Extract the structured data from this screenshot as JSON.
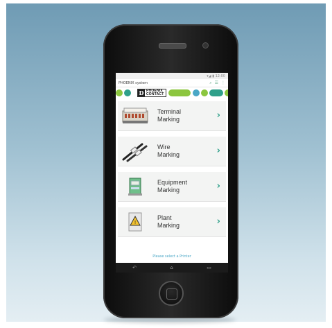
{
  "statusbar": {
    "text": "▾◢ ▮ 12:00"
  },
  "appbar": {
    "title": "PHOENIX system",
    "icons": [
      "search-icon",
      "list-icon",
      "more-icon"
    ],
    "icon_glyphs": [
      "⌕",
      "☰",
      "⋮"
    ]
  },
  "brand": {
    "mark": "D",
    "name_line1": "PHOENIX",
    "name_line2": "CONTACT",
    "colors": {
      "green": "#8cc63f",
      "teal": "#2fa08a",
      "blue": "#4aa7c6"
    }
  },
  "menu": [
    {
      "line1": "Terminal",
      "line2": "Marking",
      "icon": "terminal-block-icon"
    },
    {
      "line1": "Wire",
      "line2": "Marking",
      "icon": "wire-icon"
    },
    {
      "line1": "Equipment",
      "line2": "Marking",
      "icon": "equipment-icon"
    },
    {
      "line1": "Plant",
      "line2": "Marking",
      "icon": "plant-sign-icon"
    }
  ],
  "chevron": "›",
  "footer": {
    "hint": "Please select a Printer"
  },
  "navbar": {
    "back": "↶",
    "home": "⌂",
    "recents": "▭"
  }
}
